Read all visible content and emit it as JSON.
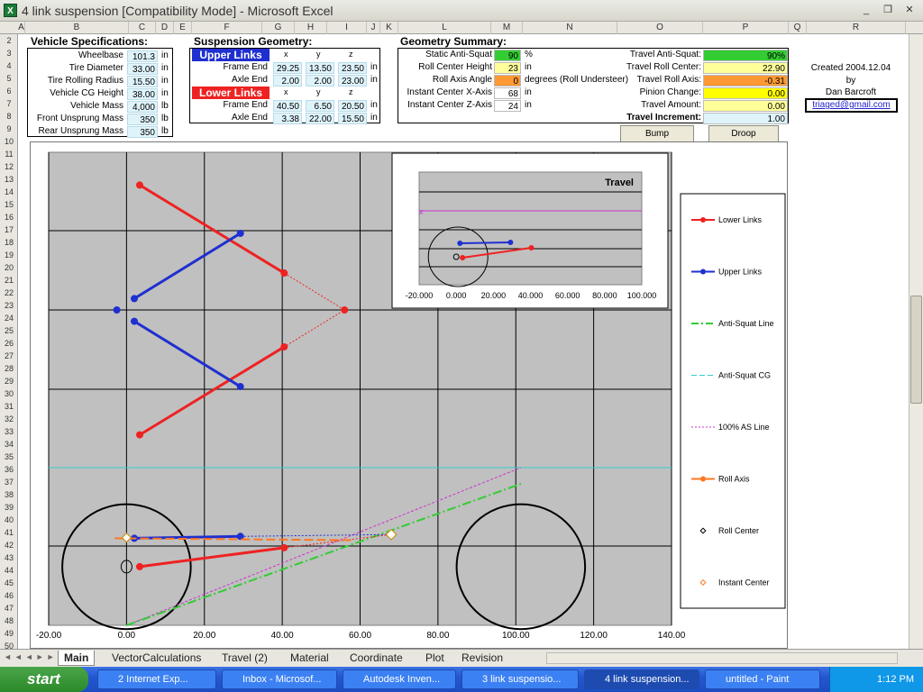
{
  "window": {
    "title": "4 link suspension  [Compatibility Mode] - Microsoft Excel",
    "minimize": "_",
    "restore": "❐",
    "close": "✕"
  },
  "columns": [
    "A",
    "B",
    "C",
    "D",
    "E",
    "F",
    "G",
    "H",
    "I",
    "J",
    "K",
    "L",
    "M",
    "N",
    "O",
    "P",
    "Q",
    "R"
  ],
  "rows": [
    "2",
    "3",
    "4",
    "5",
    "6",
    "7",
    "8",
    "9",
    "10",
    "11",
    "12",
    "13",
    "14",
    "15",
    "16",
    "17",
    "18",
    "19",
    "20",
    "21",
    "22",
    "23",
    "24",
    "25",
    "26",
    "27",
    "28",
    "29",
    "30",
    "31",
    "32",
    "33",
    "34",
    "35",
    "36",
    "37",
    "38",
    "39",
    "40",
    "41",
    "42",
    "43",
    "44",
    "45",
    "46",
    "47",
    "48",
    "49",
    "50"
  ],
  "vehicle": {
    "title": "Vehicle Specifications:",
    "rows": [
      {
        "label": "Wheelbase",
        "value": "101.3",
        "unit": "in"
      },
      {
        "label": "Tire Diameter",
        "value": "33.00",
        "unit": "in"
      },
      {
        "label": "Tire Rolling Radius",
        "value": "15.50",
        "unit": "in"
      },
      {
        "label": "Vehicle CG Height",
        "value": "38.00",
        "unit": "in"
      },
      {
        "label": "Vehicle Mass",
        "value": "4,000",
        "unit": "lb"
      },
      {
        "label": "Front Unsprung Mass",
        "value": "350",
        "unit": "lb"
      },
      {
        "label": "Rear Unsprung Mass",
        "value": "350",
        "unit": "lb"
      }
    ]
  },
  "geometry": {
    "title": "Suspension Geometry:",
    "upper": {
      "title": "Upper Links",
      "x": "x",
      "y": "y",
      "z": "z",
      "rows": [
        {
          "label": "Frame End",
          "x": "29.25",
          "y": "13.50",
          "z": "23.50",
          "unit": "in"
        },
        {
          "label": "Axle End",
          "x": "2.00",
          "y": "2.00",
          "z": "23.00",
          "unit": "in"
        }
      ]
    },
    "lower": {
      "title": "Lower Links",
      "x": "x",
      "y": "y",
      "z": "z",
      "rows": [
        {
          "label": "Frame End",
          "x": "40.50",
          "y": "6.50",
          "z": "20.50",
          "unit": "in"
        },
        {
          "label": "Axle End",
          "x": "3.38",
          "y": "22.00",
          "z": "15.50",
          "unit": "in"
        }
      ]
    }
  },
  "summary": {
    "title": "Geometry Summary:",
    "left": [
      {
        "label": "Static Anti-Squat",
        "value": "90",
        "unit": "%",
        "color": "#33cc33"
      },
      {
        "label": "Roll Center Height",
        "value": "23",
        "unit": "in",
        "color": "#ffff99"
      },
      {
        "label": "Roll Axis Angle",
        "value": "0",
        "unit": "degrees (Roll Understeer)",
        "color": "#ff9933"
      },
      {
        "label": "Instant Center X-Axis",
        "value": "68",
        "unit": "in",
        "color": "#ffffff"
      },
      {
        "label": "Instant Center Z-Axis",
        "value": "24",
        "unit": "in",
        "color": "#ffffff"
      }
    ],
    "right": [
      {
        "label": "Travel Anti-Squat:",
        "value": "90%",
        "color": "#33cc33"
      },
      {
        "label": "Travel Roll Center:",
        "value": "22.90",
        "color": "#ffff99"
      },
      {
        "label": "Travel Roll Axis:",
        "value": "-0.31",
        "color": "#ff9933"
      },
      {
        "label": "Pinion Change:",
        "value": "0.00",
        "color": "#ffff00"
      },
      {
        "label": "Travel Amount:",
        "value": "0.00",
        "color": "#ffff99"
      },
      {
        "label": "Travel Increment:",
        "value": "1.00",
        "color": "#dff3fb"
      }
    ],
    "bump": "Bump",
    "droop": "Droop"
  },
  "credits": {
    "created": "Created 2004.12.04",
    "by": "by",
    "author": "Dan Barcroft",
    "email": "triaged@gmail.com"
  },
  "chart_data": [
    {
      "type": "line",
      "xlim": [
        -20,
        140
      ],
      "xticks": [
        "-20.00",
        "0.00",
        "20.00",
        "40.00",
        "60.00",
        "80.00",
        "100.00",
        "120.00",
        "140.00"
      ],
      "legend_position": "right",
      "series": [
        {
          "name": "Lower Links",
          "color": "#ee2222"
        },
        {
          "name": "Upper Links",
          "color": "#1f2fd0"
        },
        {
          "name": "Anti-Squat Line",
          "color": "#33cc33"
        },
        {
          "name": "Anti-Squat CG",
          "color": "#33cccc"
        },
        {
          "name": "100% AS Line",
          "color": "#cc33cc"
        },
        {
          "name": "Roll Axis",
          "color": "#ff7722"
        },
        {
          "name": "Roll Center",
          "color": "#000000"
        },
        {
          "name": "Instant Center",
          "color": "#ff7722"
        }
      ],
      "top_view": {
        "lower_links": [
          [
            [
              3.38,
              22.0
            ],
            [
              40.5,
              6.5
            ],
            [
              3.38,
              -22.0
            ]
          ],
          [
            [
              40.5,
              6.5
            ],
            [
              56.0,
              0.0
            ],
            [
              40.5,
              -6.5
            ]
          ]
        ],
        "upper_links": [
          [
            [
              29.25,
              13.5
            ],
            [
              2.0,
              2.0
            ]
          ],
          [
            [
              2.0,
              -2.0
            ],
            [
              29.25,
              -13.5
            ]
          ]
        ],
        "upper_center": [
          -2.5,
          0.0
        ]
      },
      "side_view": {
        "wheels": [
          {
            "x": 0,
            "z": 15.5,
            "r": 16.5
          },
          {
            "x": 101.3,
            "z": 15.5,
            "r": 16.5
          }
        ],
        "cg_height": 38,
        "lower_link": [
          [
            3.38,
            15.5
          ],
          [
            40.5,
            20.5
          ]
        ],
        "upper_link": [
          [
            2.0,
            23.0
          ],
          [
            29.25,
            23.5
          ]
        ],
        "instant_center": [
          68,
          24
        ],
        "roll_center": [
          0,
          23
        ]
      }
    },
    {
      "type": "line",
      "title": "Travel",
      "xticks": [
        "-20.000",
        "0.000",
        "20.000",
        "40.000",
        "60.000",
        "80.000",
        "100.000"
      ],
      "xlim": [
        -20,
        100
      ]
    }
  ],
  "tabs": [
    "Main",
    "VectorCalculations",
    "Travel (2)",
    "Material",
    "Coordinate",
    "Plot",
    "Revision"
  ],
  "taskbar": {
    "start": "start",
    "buttons": [
      "2 Internet Exp...",
      "Inbox - Microsof...",
      "Autodesk Inven...",
      "3 link suspensio...",
      "4 link suspension...",
      "untitled - Paint"
    ],
    "time": "1:12 PM"
  }
}
